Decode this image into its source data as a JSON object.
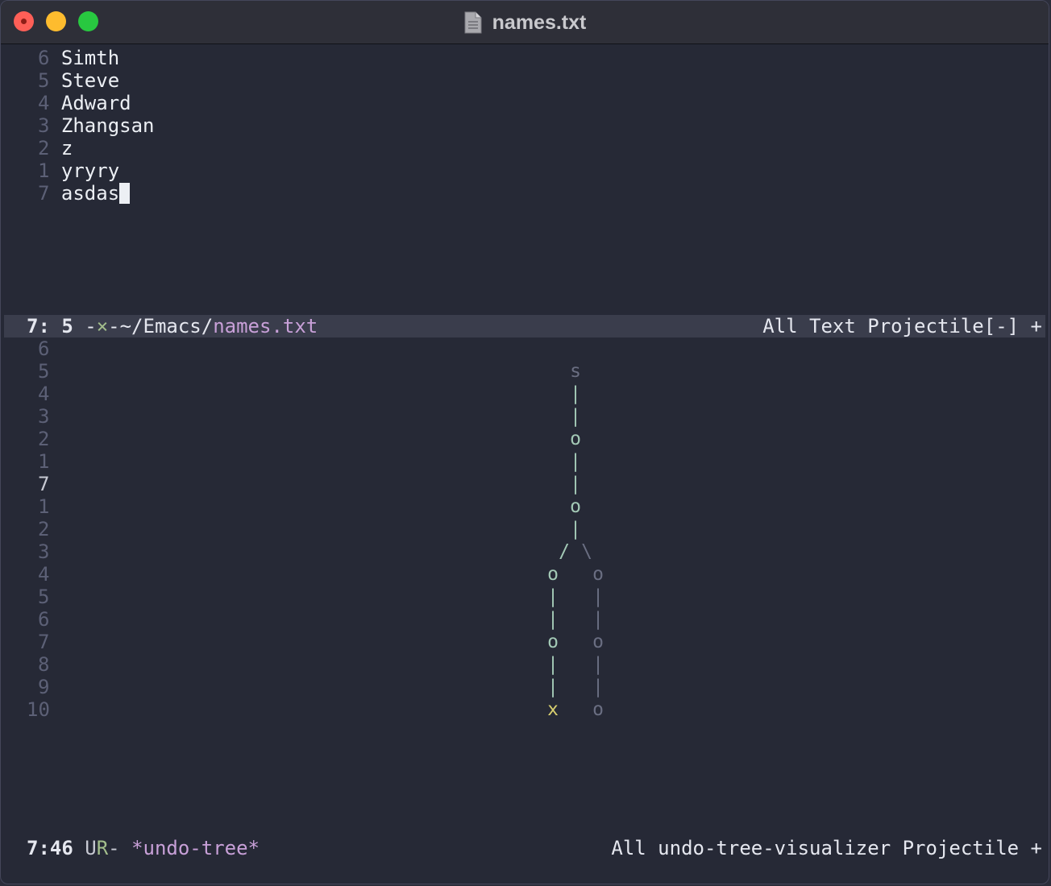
{
  "window": {
    "title": "names.txt",
    "icon": "document-icon"
  },
  "buffer": {
    "lines": [
      {
        "num": "6",
        "text": "Simth"
      },
      {
        "num": "5",
        "text": "Steve"
      },
      {
        "num": "4",
        "text": "Adward"
      },
      {
        "num": "3",
        "text": "Zhangsan"
      },
      {
        "num": "2",
        "text": "z"
      },
      {
        "num": "1",
        "text": "yryry"
      },
      {
        "num": "7",
        "text": "asdas"
      }
    ]
  },
  "modeline_top": {
    "position": "7: 5",
    "sep1": " -",
    "modified": "×",
    "sep2": "-",
    "path": "~/Emacs/",
    "filename": "names.txt",
    "right": "All Text Projectile[-] +"
  },
  "tree_lines": [
    "6",
    "5",
    "4",
    "3",
    "2",
    "1",
    "7",
    "1",
    "2",
    "3",
    "4",
    "5",
    "6",
    "7",
    "8",
    "9",
    "10"
  ],
  "undo_tree": {
    "start_node": "s",
    "node": "o",
    "current_node": "x",
    "pipe": "|",
    "branch_left": "/",
    "branch_right": "\\"
  },
  "modeline_bottom": {
    "position": "7:46",
    "flag_u": " U",
    "flag_r": "R",
    "flag_dash": "-",
    "buffer_name": "*undo-tree*",
    "right": "All undo-tree-visualizer Projectile +"
  },
  "colors": {
    "background": "#262936",
    "active_branch": "#a3c9b6",
    "inactive_branch": "#6a6e82",
    "current_node": "#d8cf6f",
    "filename": "#c8a0d8"
  }
}
